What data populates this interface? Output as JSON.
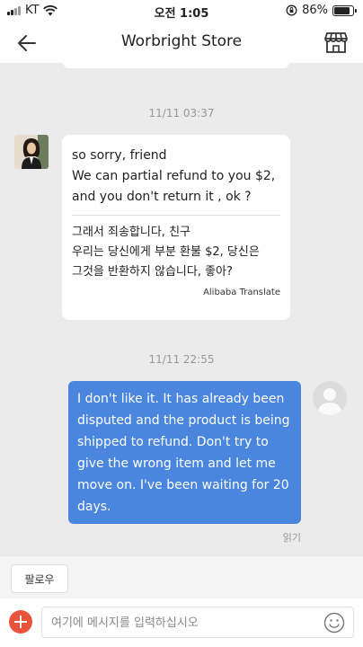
{
  "status_bar": {
    "carrier": "KT",
    "time": "오전 1:05",
    "battery": "86%",
    "battery_level": 0.86
  },
  "header": {
    "title": "Worbright Store"
  },
  "messages": {
    "ts1": "11/11 03:37",
    "seller": {
      "original_line1": "so sorry, friend",
      "original_line2": "We can partial refund to you $2,",
      "original_line3": "and you don't return it , ok ?",
      "translation_line1": "그래서 죄송합니다, 친구",
      "translation_line2": "우리는 당신에게 부분 환불 $2, 당신은",
      "translation_line3": "그것을 반환하지 않습니다, 좋아?",
      "translate_tag": "Alibaba Translate"
    },
    "ts2": "11/11 22:55",
    "user": {
      "line1": "I don't like it. It has already been",
      "line2": "disputed and the product is being",
      "line3": "shipped to refund. Don't try to",
      "line4": "give the wrong item and let me",
      "line5": "move on. I've been waiting for 20",
      "line6": "days.",
      "read_status": "읽기"
    }
  },
  "follow_button": "팔로우",
  "input": {
    "placeholder": "여기에 메시지를 입력하십시오"
  },
  "colors": {
    "accent_blue": "#4a86dd",
    "plus_red": "#e8533c"
  }
}
